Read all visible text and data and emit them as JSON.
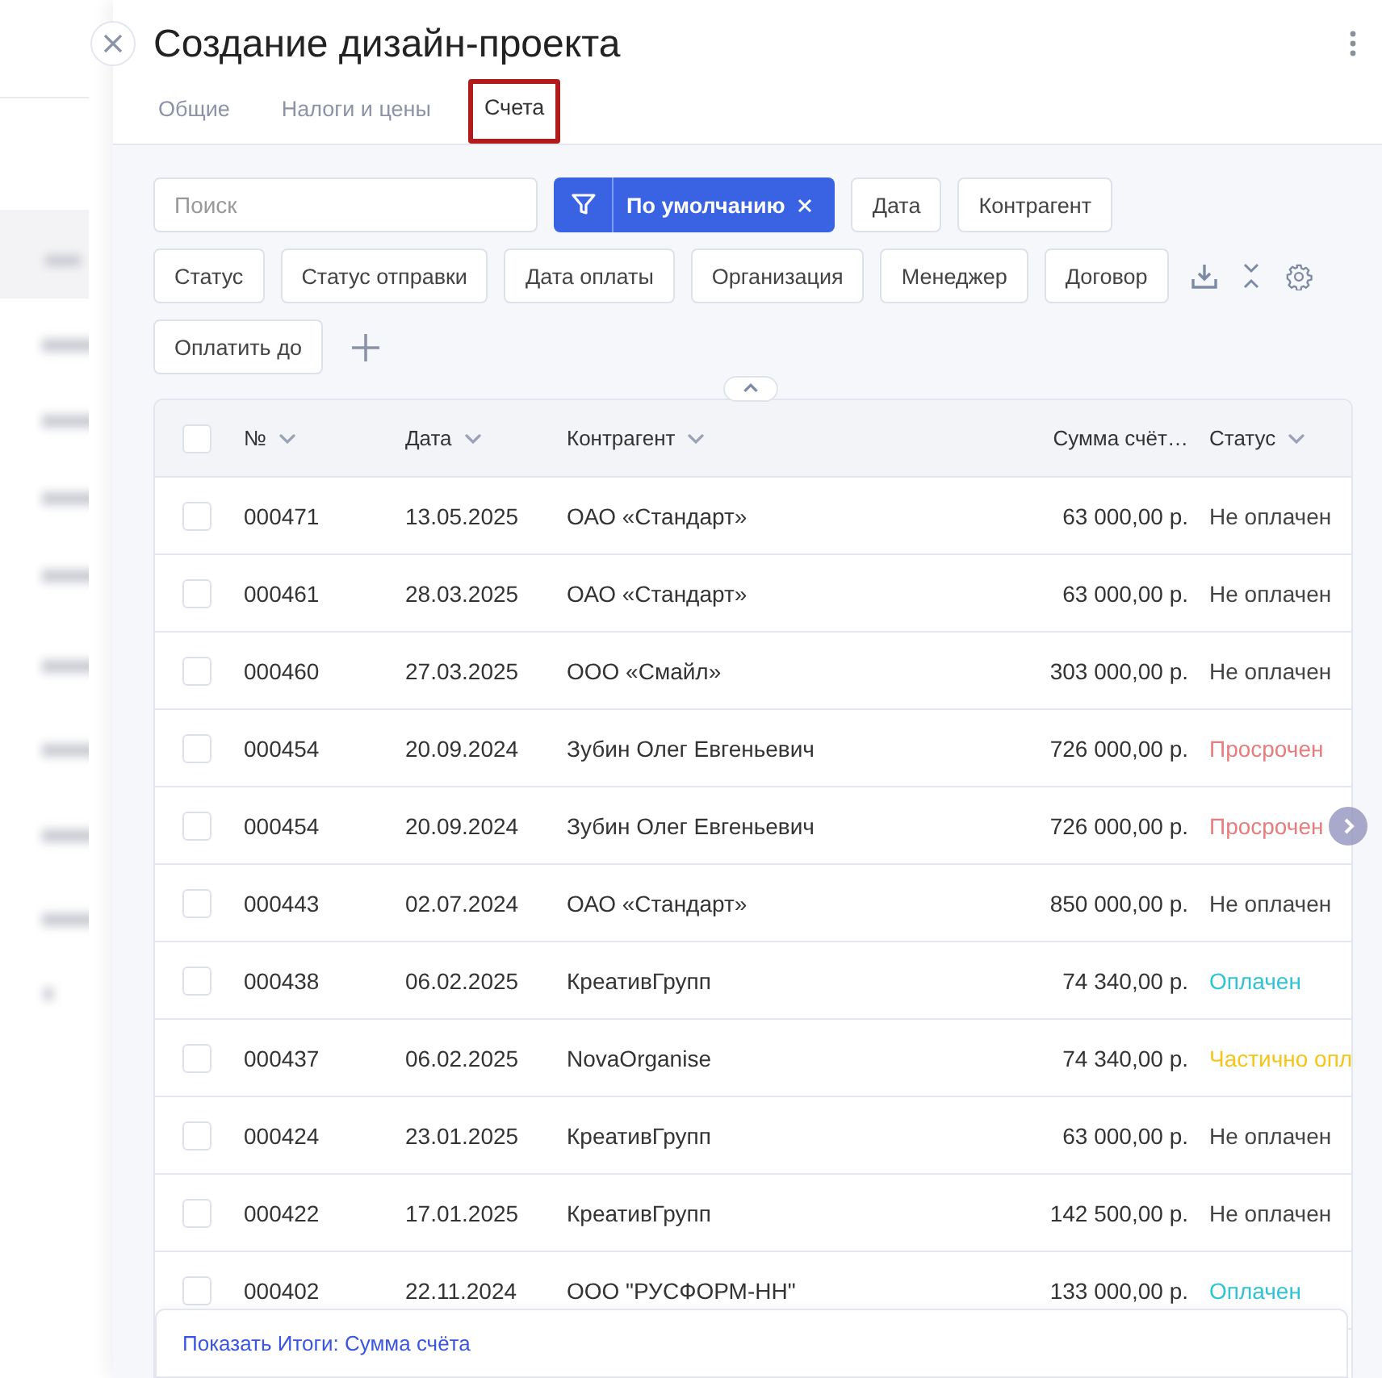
{
  "panel": {
    "title": "Создание дизайн-проекта"
  },
  "tabs": [
    {
      "label": "Общие",
      "selected": false
    },
    {
      "label": "Налоги и цены",
      "selected": false
    },
    {
      "label": "Счета",
      "selected": true
    }
  ],
  "toolbar": {
    "search": {
      "placeholder": "Поиск"
    },
    "preset": {
      "label": "По умолчанию"
    },
    "chip_rows": [
      [
        "Дата",
        "Контрагент"
      ],
      [
        "Статус",
        "Статус отправки",
        "Дата оплаты",
        "Организация",
        "Менеджер",
        "Договор"
      ],
      [
        "Оплатить до"
      ]
    ]
  },
  "table": {
    "all_checked": false,
    "columns": [
      {
        "label": "№",
        "sortable": true
      },
      {
        "label": "Дата",
        "sortable": true
      },
      {
        "label": "Контрагент",
        "sortable": true
      },
      {
        "label": "Сумма счёт…",
        "sortable": false
      },
      {
        "label": "Статус",
        "sortable": true
      }
    ],
    "rows": [
      {
        "checked": false,
        "number": "000471",
        "date": "13.05.2025",
        "counterparty": "ОАО «Стандарт»",
        "amount": "63 000,00 р.",
        "status": "Не оплачен",
        "color": "#444444"
      },
      {
        "checked": false,
        "number": "000461",
        "date": "28.03.2025",
        "counterparty": "ОАО «Стандарт»",
        "amount": "63 000,00 р.",
        "status": "Не оплачен",
        "color": "#444444"
      },
      {
        "checked": false,
        "number": "000460",
        "date": "27.03.2025",
        "counterparty": "ООО «Смайл»",
        "amount": "303 000,00 р.",
        "status": "Не оплачен",
        "color": "#444444"
      },
      {
        "checked": false,
        "number": "000454",
        "date": "20.09.2024",
        "counterparty": "Зубин Олег Евгеньевич",
        "amount": "726 000,00 р.",
        "status": "Просрочен",
        "color": "#e87b7b"
      },
      {
        "checked": false,
        "number": "000454",
        "date": "20.09.2024",
        "counterparty": "Зубин Олег Евгеньевич",
        "amount": "726 000,00 р.",
        "status": "Просрочен",
        "color": "#e87b7b"
      },
      {
        "checked": false,
        "number": "000443",
        "date": "02.07.2024",
        "counterparty": "ОАО «Стандарт»",
        "amount": "850 000,00 р.",
        "status": "Не оплачен",
        "color": "#444444"
      },
      {
        "checked": false,
        "number": "000438",
        "date": "06.02.2025",
        "counterparty": "КреативГрупп",
        "amount": "74 340,00 р.",
        "status": "Оплачен",
        "color": "#2ec4d6"
      },
      {
        "checked": false,
        "number": "000437",
        "date": "06.02.2025",
        "counterparty": "NovaOrganise",
        "amount": "74 340,00 р.",
        "status": "Частично опл",
        "color": "#f5c518"
      },
      {
        "checked": false,
        "number": "000424",
        "date": "23.01.2025",
        "counterparty": "КреативГрупп",
        "amount": "63 000,00 р.",
        "status": "Не оплачен",
        "color": "#444444"
      },
      {
        "checked": false,
        "number": "000422",
        "date": "17.01.2025",
        "counterparty": "КреативГрупп",
        "amount": "142 500,00 р.",
        "status": "Не оплачен",
        "color": "#444444"
      },
      {
        "checked": false,
        "number": "000402",
        "date": "22.11.2024",
        "counterparty": "ООО \"РУСФОРМ-НН\"",
        "amount": "133 000,00 р.",
        "status": "Оплачен",
        "color": "#2ec4d6"
      }
    ],
    "footer_link": "Показать Итоги: Сумма счёта"
  }
}
